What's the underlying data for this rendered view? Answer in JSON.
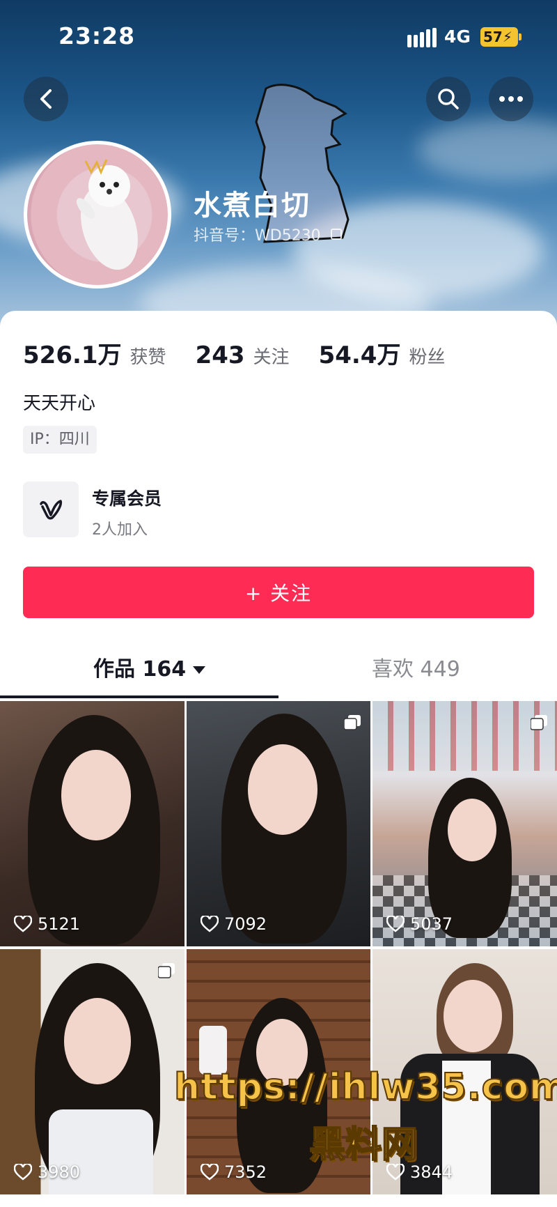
{
  "status_bar": {
    "time": "23:28",
    "network": "4G",
    "battery": "57"
  },
  "profile": {
    "name": "水煮白切",
    "douyin_id": "抖音号：WD5230",
    "bio": "天天开心",
    "ip": "IP：四川"
  },
  "stats": [
    {
      "value": "526.1万",
      "label": "获赞"
    },
    {
      "value": "243",
      "label": "关注"
    },
    {
      "value": "54.4万",
      "label": "粉丝"
    }
  ],
  "membership": {
    "title": "专属会员",
    "subtitle": "2人加入"
  },
  "follow_button": "+ 关注",
  "tabs": {
    "works": "作品 164",
    "likes": "喜欢 449"
  },
  "videos": [
    {
      "likes": "5121",
      "multi": false
    },
    {
      "likes": "7092",
      "multi": true
    },
    {
      "likes": "5037",
      "multi": true
    },
    {
      "likes": "3980",
      "multi": true
    },
    {
      "likes": "7352",
      "multi": false
    },
    {
      "likes": "3844",
      "multi": false
    }
  ],
  "watermark": {
    "url": "https://ihlw35.com",
    "name": "黑料网"
  },
  "colors": {
    "accent": "#fe2c55",
    "text": "#161823",
    "muted": "#8a8b91"
  },
  "icons": [
    "back-icon",
    "search-icon",
    "more-icon",
    "copy-icon",
    "member-v-icon",
    "heart-icon",
    "multi-image-icon",
    "signal-icon"
  ]
}
